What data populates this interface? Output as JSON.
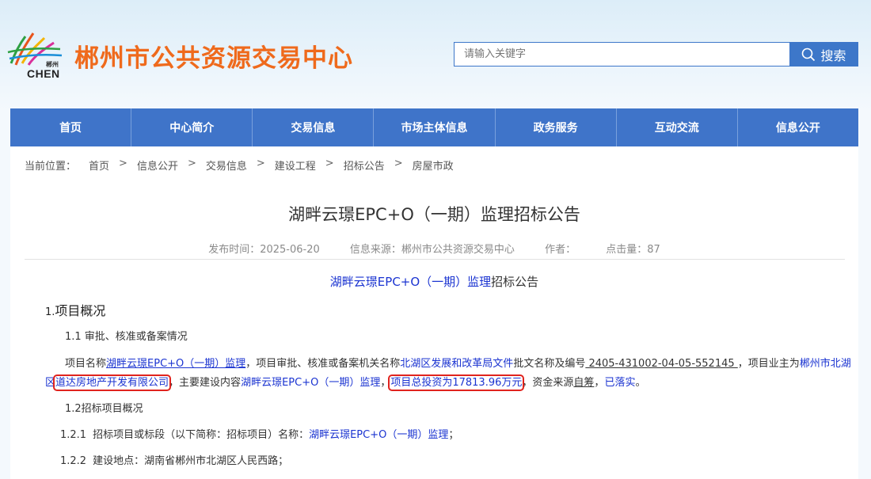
{
  "header": {
    "logo_text": "CHEN",
    "logo_small_text": "郴州",
    "site_title": "郴州市公共资源交易中心",
    "search_placeholder": "请输入关键字",
    "search_button": "搜索",
    "accent_color": "#3f74c9",
    "title_color": "#ef6a1c"
  },
  "nav": {
    "items": [
      {
        "label": "首页"
      },
      {
        "label": "中心简介"
      },
      {
        "label": "交易信息"
      },
      {
        "label": "市场主体信息"
      },
      {
        "label": "政务服务"
      },
      {
        "label": "互动交流"
      },
      {
        "label": "信息公开"
      }
    ]
  },
  "breadcrumb": {
    "lead": "当前位置：",
    "items": [
      "首页",
      "信息公开",
      "交易信息",
      "建设工程",
      "招标公告",
      "房屋市政"
    ],
    "separator": ">"
  },
  "article": {
    "title": "湖畔云璟EPC+O（一期）监理招标公告",
    "meta": {
      "publish_label": "发布时间：",
      "publish_date": "2025-06-20",
      "source_label": "信息来源：",
      "source": "郴州市公共资源交易中心",
      "author_label": "作者：",
      "author": "",
      "clicks_label": "点击量：",
      "clicks": "87"
    },
    "sub_title_blue": "湖畔云璟EPC+O（一期）监理",
    "sub_title_rest": "招标公告",
    "section1_num": "1.",
    "section1_title": "项目概况",
    "s11": "1.1 审批、核准或备案情况",
    "p1": {
      "a": "项目名称",
      "b": "湖畔云璟EPC+O（一期）监理",
      "c": "，项目审批、核准或备案机关名称",
      "d": "北湖区发展和改革局文件",
      "e": "批文名称及编号",
      "f": " 2405-431002-04-05-552145 ",
      "g": "，项目业主为",
      "h": "郴州市北湖"
    },
    "p2": {
      "a": "区",
      "b": "道达房地产开发有限公司",
      "c": "，",
      "d": "主要建设内容",
      "e": "湖畔云璟EPC+O（一期）监理",
      "f": "，",
      "g": "项目总投资为17813.96万元",
      "h": "，",
      "i": "资金来源",
      "j": "自筹",
      "k": "，",
      "l": "已落实",
      "m": "。"
    },
    "s12": "1.2招标项目概况",
    "s121_num": "1.2.1",
    "s121_label": "招标项目或标段（以下简称：招标项目）名称：",
    "s121_value": "湖畔云璟EPC+O（一期）监理",
    "s121_end": "；",
    "s122_num": "1.2.2",
    "s122_text": "建设地点：湖南省郴州市北湖区人民西路；"
  }
}
